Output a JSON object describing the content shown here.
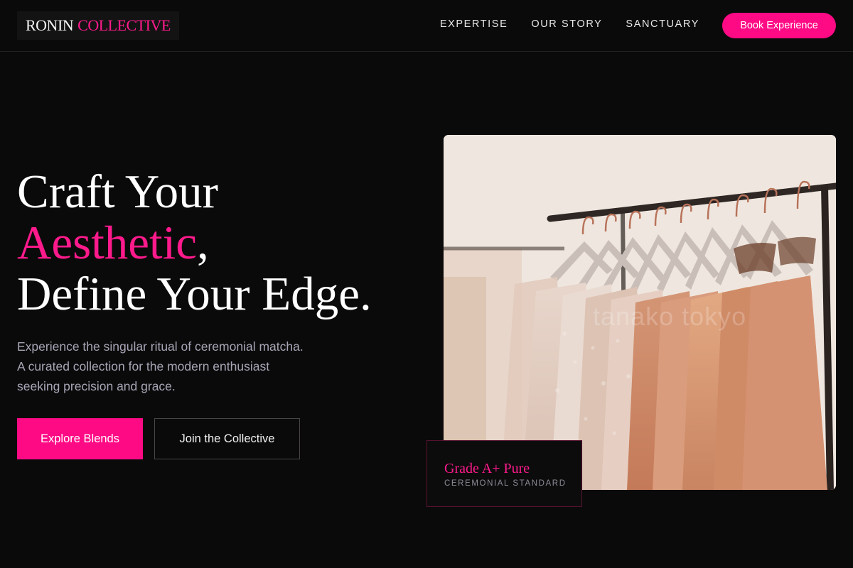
{
  "brand": {
    "word1": "RONIN",
    "word2": "COLLECTIVE"
  },
  "nav": {
    "items": [
      {
        "label": "EXPERTISE"
      },
      {
        "label": "OUR STORY"
      },
      {
        "label": "SANCTUARY"
      }
    ],
    "cta_label": "Book Experience"
  },
  "hero": {
    "line1": "Craft Your",
    "accent_word": "Aesthetic",
    "accent_punct": ",",
    "line3": "Define Your Edge.",
    "description_lines": [
      "Experience the singular ritual of ceremonial matcha.",
      "A curated collection for the modern enthusiast",
      "seeking precision and grace."
    ],
    "primary_button": "Explore Blends",
    "secondary_button": "Join the Collective"
  },
  "image": {
    "watermark": "tanako tokyo",
    "icon": "clothing-rack-photo"
  },
  "badge": {
    "title": "Grade A+ Pure",
    "subtitle": "CEREMONIAL STANDARD"
  },
  "colors": {
    "accent": "#ff0a85",
    "background": "#0b0a0b",
    "muted_text": "#a9a5b5"
  }
}
